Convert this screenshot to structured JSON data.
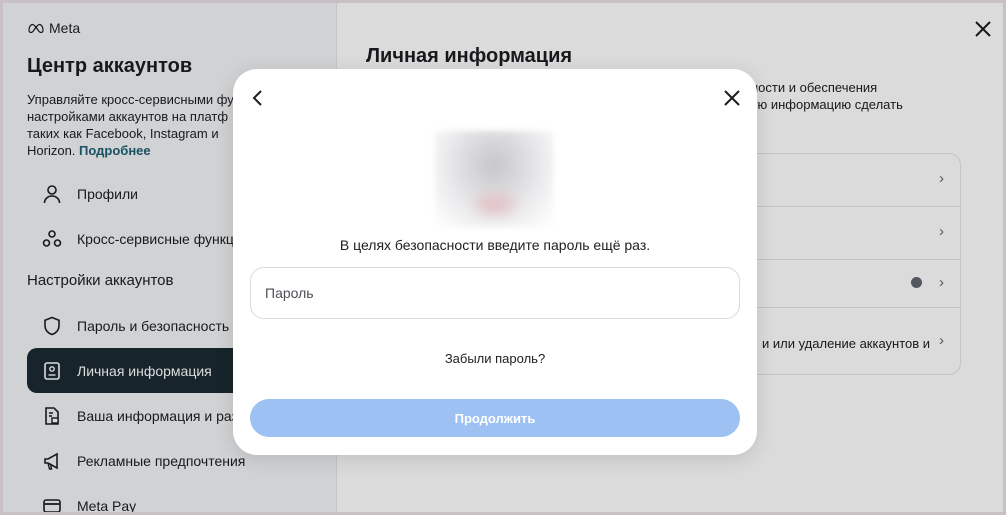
{
  "brand": {
    "name": "Meta"
  },
  "sidebar": {
    "title": "Центр аккаунтов",
    "description": "Управляйте кросс-сервисными фу",
    "description_line2": "настройками аккаунтов на платф",
    "description_line3": "таких как Facebook, Instagram и",
    "description_line4": "Horizon.",
    "more_link": "Подробнее",
    "top_items": [
      {
        "label": "Профили",
        "icon": "person-icon"
      },
      {
        "label": "Кросс-сервисные функци",
        "icon": "connected-nodes-icon"
      }
    ],
    "section_heading": "Настройки аккаунтов",
    "settings_items": [
      {
        "label": "Пароль и безопасность",
        "icon": "shield-icon"
      },
      {
        "label": "Личная информация",
        "icon": "id-card-icon",
        "active": true
      },
      {
        "label": "Ваша информация и разр",
        "icon": "document-lock-icon"
      },
      {
        "label": "Рекламные предпочтения",
        "icon": "megaphone-icon"
      },
      {
        "label": "Meta Pay",
        "icon": "credit-card-icon"
      }
    ]
  },
  "main": {
    "title": "Личная информация",
    "description_line1": "ности и обеспечения",
    "description_line2": "ую информацию сделать",
    "rows": [
      {
        "label": ""
      },
      {
        "label": ""
      },
      {
        "label": ""
      },
      {
        "label": "и или удаление аккаунтов и"
      }
    ]
  },
  "modal": {
    "prompt": "В целях безопасности введите пароль ещё раз.",
    "password_placeholder": "Пароль",
    "forgot_link": "Забыли пароль?",
    "continue_label": "Продолжить"
  },
  "colors": {
    "active_nav_bg": "#1c2b33",
    "continue_disabled": "#9cc1f2",
    "link": "#1e5f74"
  }
}
